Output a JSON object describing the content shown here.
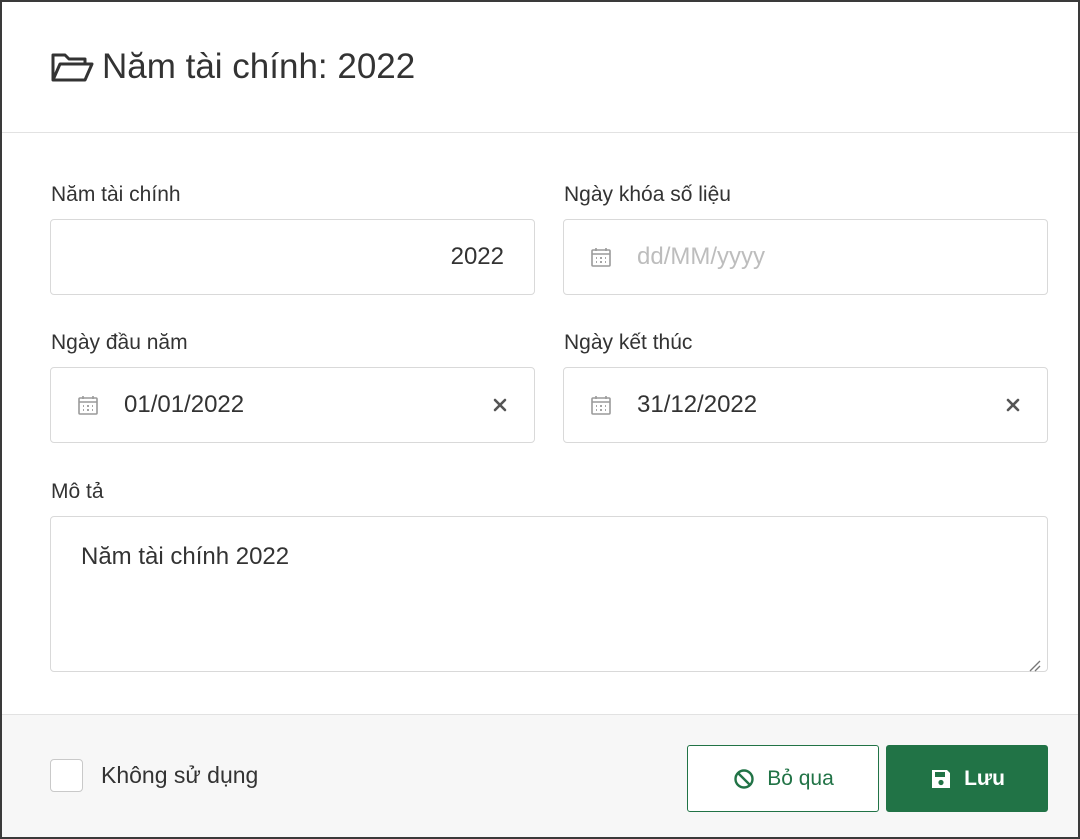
{
  "modal": {
    "title_icon": "folder-open-icon",
    "title": "Năm tài chính: 2022"
  },
  "form": {
    "fiscal_year": {
      "label": "Năm tài chính",
      "value": "2022"
    },
    "lock_date": {
      "label": "Ngày khóa số liệu",
      "placeholder": "dd/MM/yyyy",
      "icon": "calendar-icon"
    },
    "start_date": {
      "label": "Ngày đầu năm",
      "value": "01/01/2022",
      "icon": "calendar-icon",
      "clear_icon": "close-icon"
    },
    "end_date": {
      "label": "Ngày kết thúc",
      "value": "31/12/2022",
      "icon": "calendar-icon",
      "clear_icon": "close-icon"
    },
    "description": {
      "label": "Mô tả",
      "value": "Năm tài chính 2022"
    }
  },
  "footer": {
    "inactive_label": "Không sử dụng",
    "inactive_checked": false,
    "cancel_label": "Bỏ qua",
    "cancel_icon": "ban-icon",
    "save_label": "Lưu",
    "save_icon": "save-icon"
  },
  "colors": {
    "accent": "#217346",
    "border": "#d9d9d9",
    "placeholder": "#bdbdbd"
  }
}
